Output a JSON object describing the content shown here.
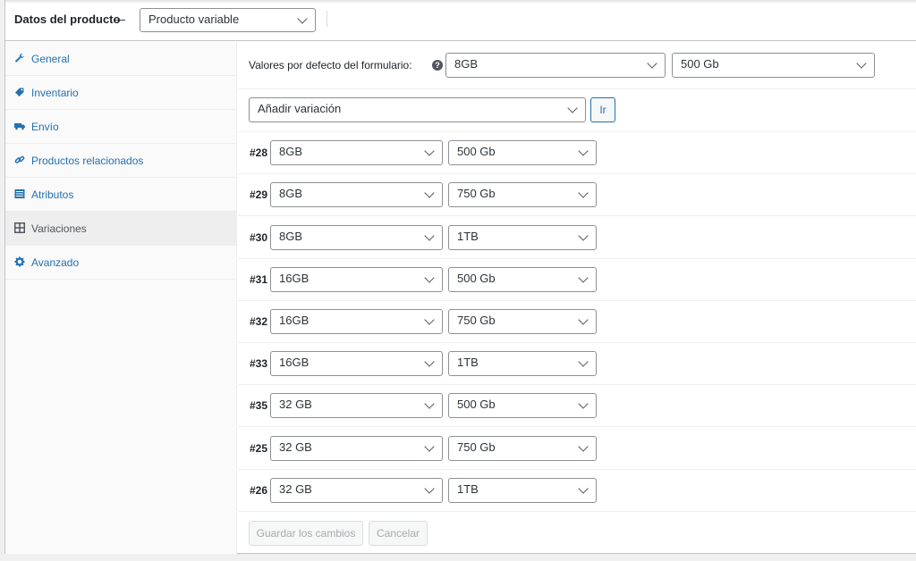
{
  "header": {
    "title": "Datos del producto",
    "dash": "—",
    "product_type": "Producto variable"
  },
  "sidebar": {
    "items": [
      {
        "label": "General",
        "icon": "wrench-icon"
      },
      {
        "label": "Inventario",
        "icon": "tag-icon"
      },
      {
        "label": "Envío",
        "icon": "truck-icon"
      },
      {
        "label": "Productos relacionados",
        "icon": "link-icon"
      },
      {
        "label": "Atributos",
        "icon": "list-icon"
      },
      {
        "label": "Variaciones",
        "icon": "grid-icon",
        "active": true
      },
      {
        "label": "Avanzado",
        "icon": "gear-icon"
      }
    ]
  },
  "defaults": {
    "label": "Valores por defecto del formulario:",
    "help": "?",
    "memory": "8GB",
    "storage": "500 Gb"
  },
  "add_variation": {
    "select": "Añadir variación",
    "go": "Ir"
  },
  "variations": [
    {
      "id": "#28",
      "memory": "8GB",
      "storage": "500 Gb"
    },
    {
      "id": "#29",
      "memory": "8GB",
      "storage": "750 Gb"
    },
    {
      "id": "#30",
      "memory": "8GB",
      "storage": "1TB"
    },
    {
      "id": "#31",
      "memory": "16GB",
      "storage": "500 Gb"
    },
    {
      "id": "#32",
      "memory": "16GB",
      "storage": "750 Gb"
    },
    {
      "id": "#33",
      "memory": "16GB",
      "storage": "1TB"
    },
    {
      "id": "#35",
      "memory": "32 GB",
      "storage": "500 Gb"
    },
    {
      "id": "#25",
      "memory": "32 GB",
      "storage": "750 Gb"
    },
    {
      "id": "#26",
      "memory": "32 GB",
      "storage": "1TB"
    }
  ],
  "actions": {
    "save": "Guardar los cambios",
    "cancel": "Cancelar"
  }
}
